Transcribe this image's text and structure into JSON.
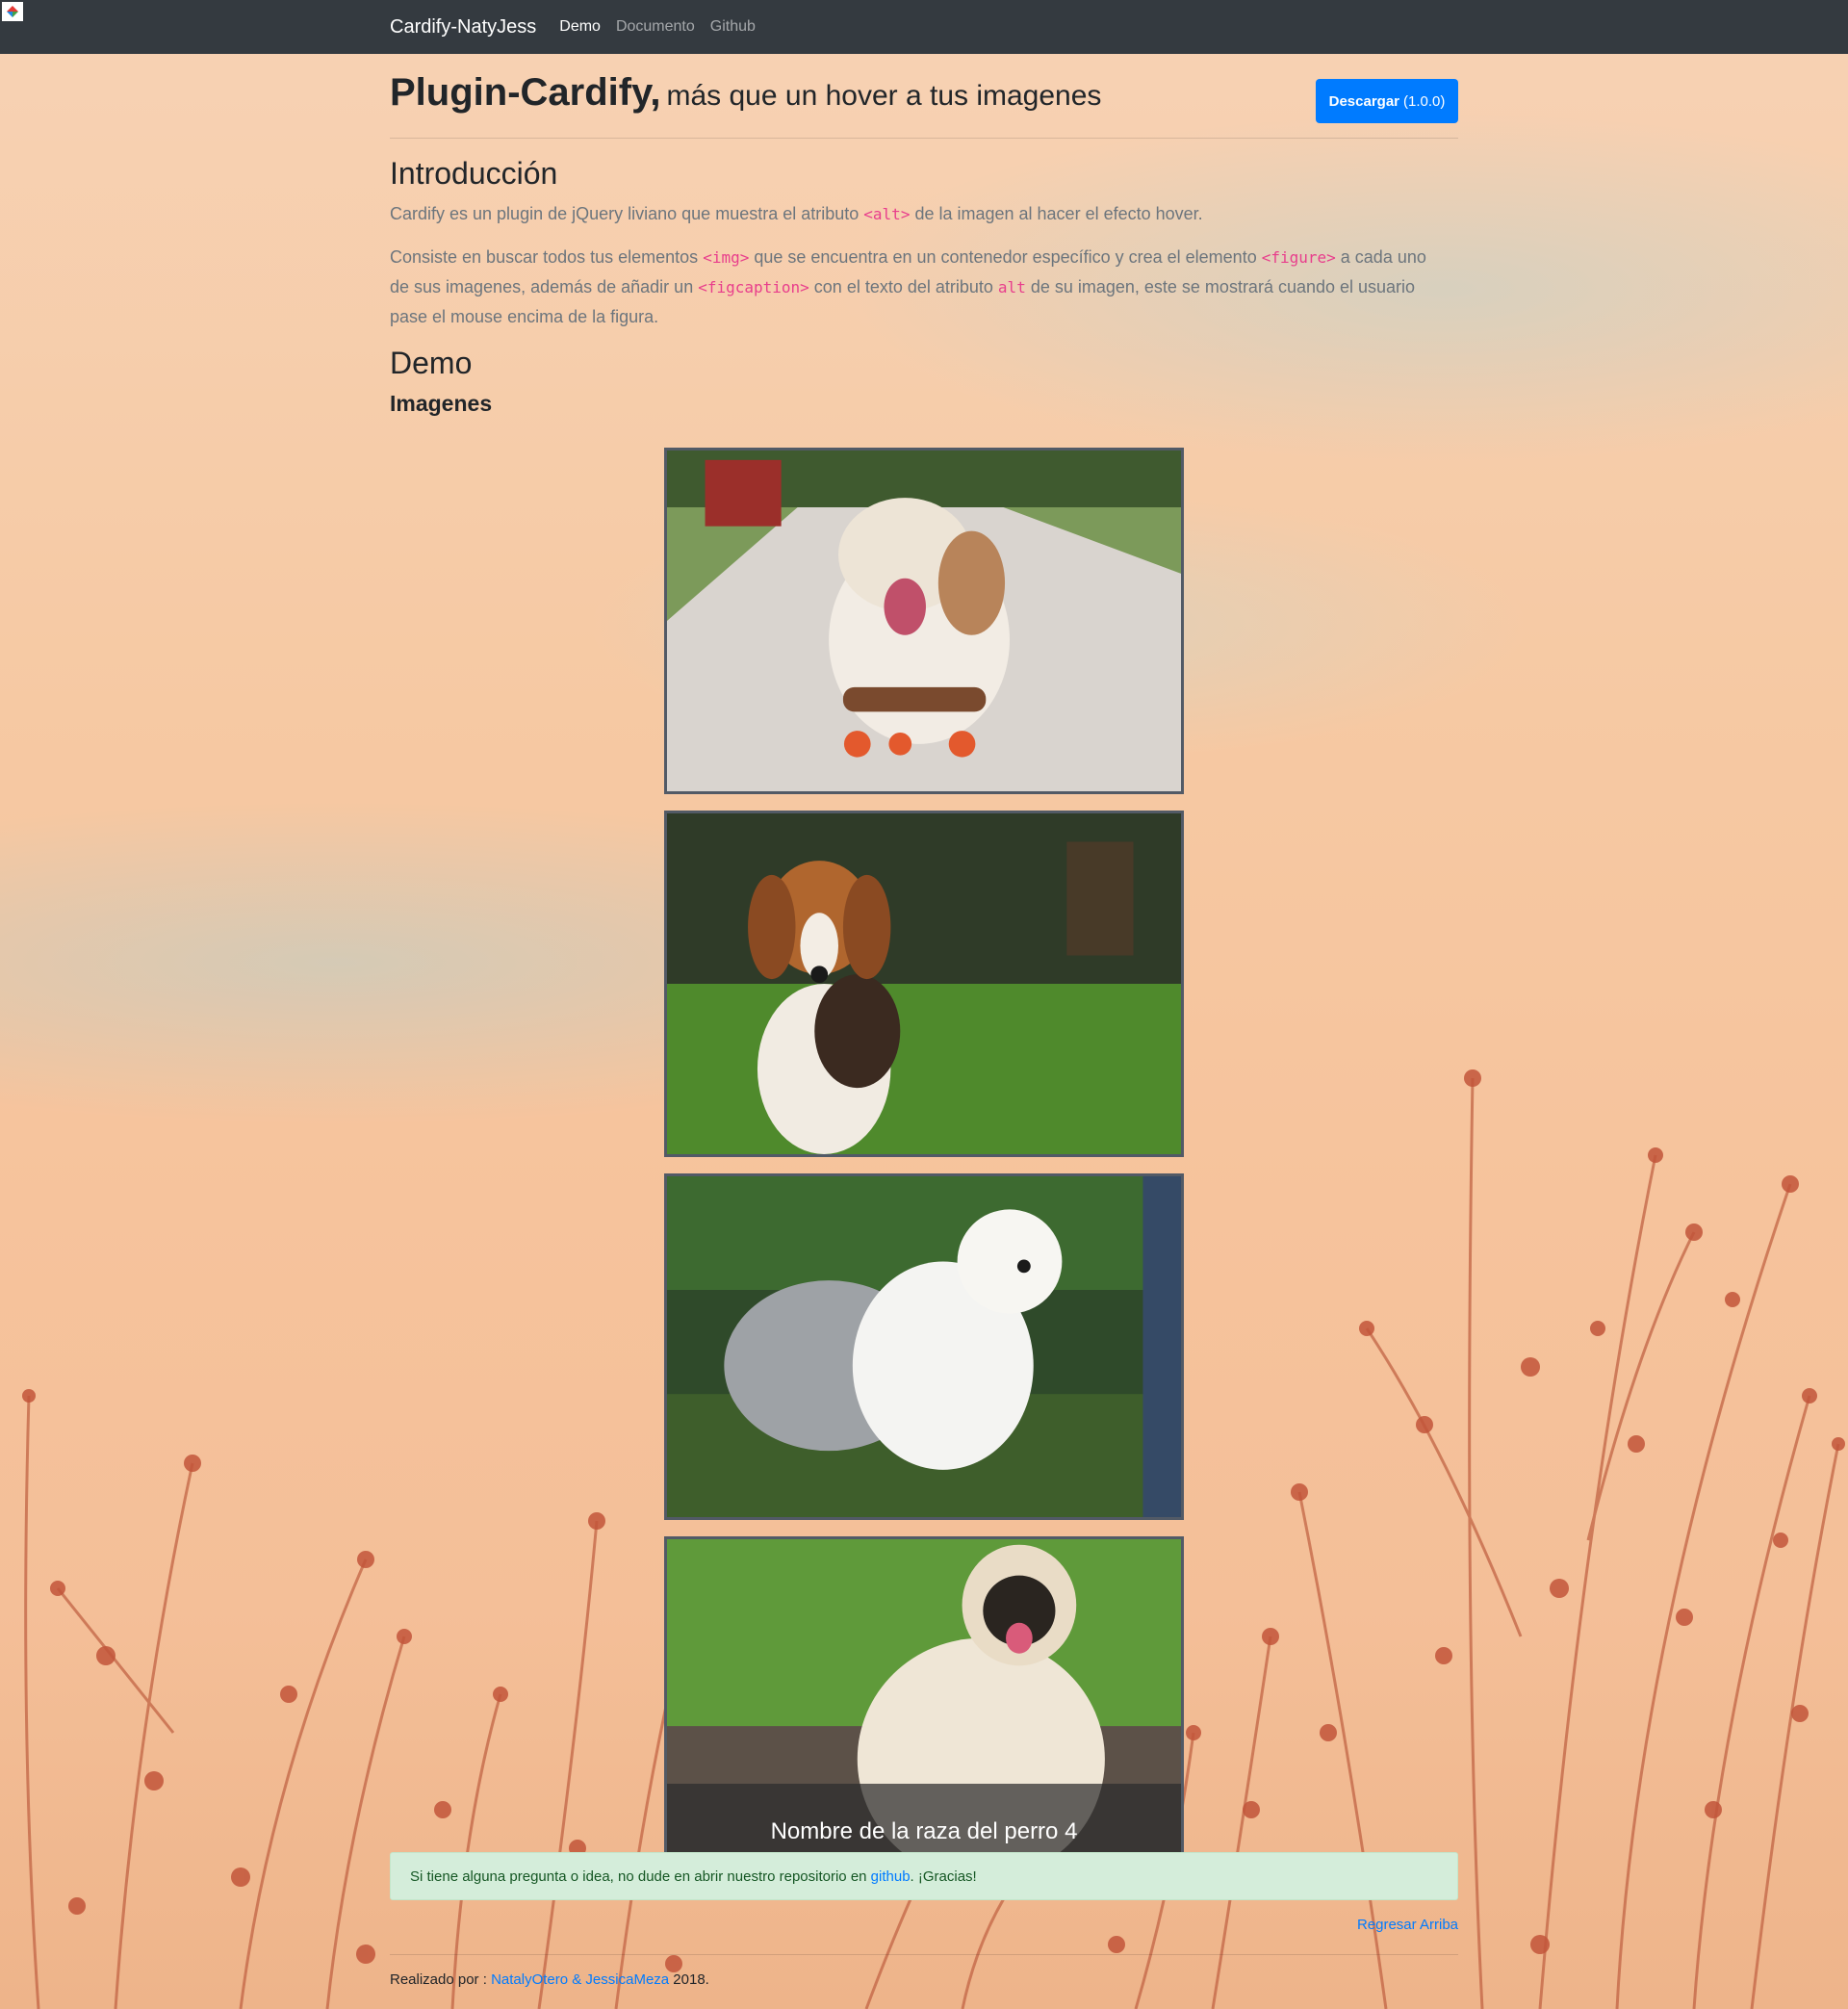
{
  "navbar": {
    "brand": "Cardify-NatyJess",
    "links": [
      "Demo",
      "Documento",
      "Github"
    ]
  },
  "header": {
    "title": "Plugin-Cardify,",
    "subtitle": "más que un hover a tus imagenes",
    "download_label": "Descargar",
    "download_version": "(1.0.0)"
  },
  "intro": {
    "heading": "Introducción",
    "p1_before": "Cardify es un plugin de jQuery liviano que muestra el atributo ",
    "p1_code": "<alt>",
    "p1_after": " de la imagen al hacer el efecto hover.",
    "p2_a": "Consiste en buscar todos tus elementos ",
    "p2_code1": "<img>",
    "p2_b": " que se encuentra en un contenedor específico y crea el elemento ",
    "p2_code2": "<figure>",
    "p2_c": " a cada uno de sus imagenes, además de añadir un ",
    "p2_code3": "<figcaption>",
    "p2_d": " con el texto del atributo ",
    "p2_code4": "alt",
    "p2_e": " de su imagen, este se mostrará cuando el usuario pase el mouse encima de la figura."
  },
  "demo": {
    "heading": "Demo",
    "subheading": "Imagenes",
    "caption_4": "Nombre de la raza del perro 4"
  },
  "alert": {
    "before": "Si tiene alguna pregunta o idea, no dude en abrir nuestro repositorio en ",
    "link": "github",
    "after": ". ¡Gracias!"
  },
  "back_top": "Regresar Arriba",
  "footer": {
    "before": "Realizado por : ",
    "authors": "NatalyOtero & JessicaMeza",
    "year": " 2018."
  },
  "colors": {
    "navbar": "#343a40",
    "primary": "#007bff",
    "code": "#e83e8c",
    "alert_bg": "#d4edda"
  }
}
